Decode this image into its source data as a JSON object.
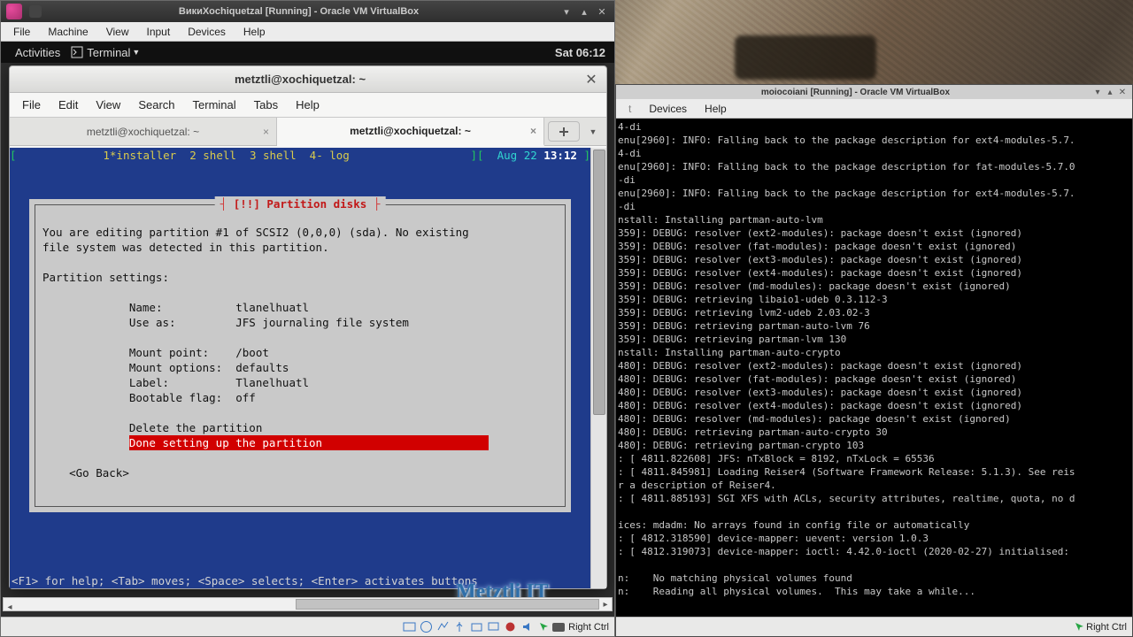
{
  "vbox1": {
    "title": "ВикиXochiquetzal [Running] - Oracle VM VirtualBox",
    "menu": [
      "File",
      "Machine",
      "View",
      "Input",
      "Devices",
      "Help"
    ],
    "status_host_key": "Right Ctrl",
    "status_icons": [
      "hdd",
      "cd",
      "net",
      "usb",
      "shared",
      "display",
      "rec",
      "audio",
      "mouse"
    ]
  },
  "gnome": {
    "activities": "Activities",
    "app_label": "Terminal",
    "clock": "Sat 06:12"
  },
  "gterm": {
    "title": "metztli@xochiquetzal: ~",
    "menu": [
      "File",
      "Edit",
      "View",
      "Search",
      "Terminal",
      "Tabs",
      "Help"
    ],
    "tabs": [
      {
        "label": "metztli@xochiquetzal: ~",
        "active": false
      },
      {
        "label": "metztli@xochiquetzal: ~",
        "active": true
      }
    ]
  },
  "screen": {
    "left_brace": "[",
    "sessions": "  1*installer  2 shell  3 shell  4- log",
    "right_group": "][  Aug 22 13:12 ]"
  },
  "installer": {
    "legend": "[!!] Partition disks",
    "body1": "You are editing partition #1 of SCSI2 (0,0,0) (sda). No existing",
    "body2": "file system was detected in this partition.",
    "settings_header": "Partition settings:",
    "rows": [
      "Name:           tlanelhuatl",
      "Use as:         JFS journaling file system",
      "",
      "Mount point:    /boot",
      "Mount options:  defaults",
      "Label:          Tlanelhuatl",
      "Bootable flag:  off"
    ],
    "delete_action": "Delete the partition",
    "done_action": "Done setting up the partition",
    "go_back": "<Go Back>",
    "hints": "<F1> for help; <Tab> moves; <Space> selects; <Enter> activates buttons"
  },
  "watermark": "Metztli IT",
  "vbox2": {
    "title": "moiocoiani [Running] - Oracle VM VirtualBox",
    "menu_partial": [
      "Devices",
      "Help"
    ],
    "status_host_key": "Right Ctrl",
    "log": [
      "4-di",
      "enu[2960]: INFO: Falling back to the package description for ext4-modules-5.7.",
      "4-di",
      "enu[2960]: INFO: Falling back to the package description for fat-modules-5.7.0",
      "-di",
      "enu[2960]: INFO: Falling back to the package description for ext4-modules-5.7.",
      "-di",
      "nstall: Installing partman-auto-lvm",
      "359]: DEBUG: resolver (ext2-modules): package doesn't exist (ignored)",
      "359]: DEBUG: resolver (fat-modules): package doesn't exist (ignored)",
      "359]: DEBUG: resolver (ext3-modules): package doesn't exist (ignored)",
      "359]: DEBUG: resolver (ext4-modules): package doesn't exist (ignored)",
      "359]: DEBUG: resolver (md-modules): package doesn't exist (ignored)",
      "359]: DEBUG: retrieving libaio1-udeb 0.3.112-3",
      "359]: DEBUG: retrieving lvm2-udeb 2.03.02-3",
      "359]: DEBUG: retrieving partman-auto-lvm 76",
      "359]: DEBUG: retrieving partman-lvm 130",
      "nstall: Installing partman-auto-crypto",
      "480]: DEBUG: resolver (ext2-modules): package doesn't exist (ignored)",
      "480]: DEBUG: resolver (fat-modules): package doesn't exist (ignored)",
      "480]: DEBUG: resolver (ext3-modules): package doesn't exist (ignored)",
      "480]: DEBUG: resolver (ext4-modules): package doesn't exist (ignored)",
      "480]: DEBUG: resolver (md-modules): package doesn't exist (ignored)",
      "480]: DEBUG: retrieving partman-auto-crypto 30",
      "480]: DEBUG: retrieving partman-crypto 103",
      ": [ 4811.822608] JFS: nTxBlock = 8192, nTxLock = 65536",
      ": [ 4811.845981] Loading Reiser4 (Software Framework Release: 5.1.3). See reis",
      "r a description of Reiser4.",
      ": [ 4811.885193] SGI XFS with ACLs, security attributes, realtime, quota, no d",
      "",
      "ices: mdadm: No arrays found in config file or automatically",
      ": [ 4812.318590] device-mapper: uevent: version 1.0.3",
      ": [ 4812.319073] device-mapper: ioctl: 4.42.0-ioctl (2020-02-27) initialised:",
      "",
      "n:    No matching physical volumes found",
      "n:    Reading all physical volumes.  This may take a while..."
    ]
  }
}
